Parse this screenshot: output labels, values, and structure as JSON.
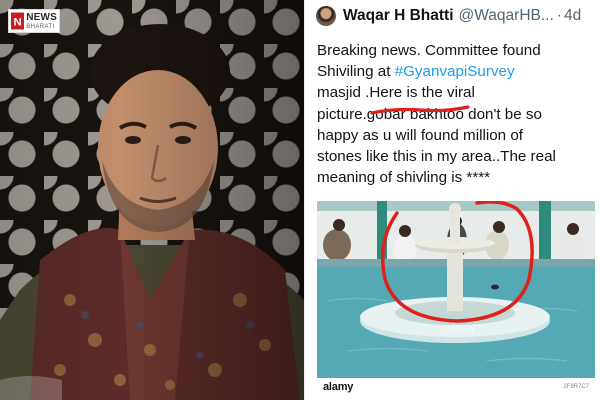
{
  "logo": {
    "line1": "NEWS",
    "line2": "BHARATI",
    "mark_letter": "N"
  },
  "tweet": {
    "display_name": "Waqar H Bhatti",
    "handle": "@WaqarHB...",
    "separator": "·",
    "time": "4d",
    "lines": [
      {
        "parts": [
          {
            "text": "Breaking news. Committee  found",
            "hashtag": false
          }
        ]
      },
      {
        "parts": [
          {
            "text": "Shiviling at ",
            "hashtag": false
          },
          {
            "text": "#GyanvapiSurvey",
            "hashtag": true
          }
        ]
      },
      {
        "parts": [
          {
            "text": "masjid  .Here is the viral",
            "hashtag": false
          }
        ]
      },
      {
        "parts": [
          {
            "text": "picture.gobar bakhtoo don't be so",
            "hashtag": false
          }
        ]
      },
      {
        "parts": [
          {
            "text": "happy as u will found  million of",
            "hashtag": false
          }
        ]
      },
      {
        "parts": [
          {
            "text": "stones like this in my area..The real",
            "hashtag": false
          }
        ]
      },
      {
        "parts": [
          {
            "text": "meaning of shivling is ****",
            "hashtag": false
          }
        ]
      }
    ],
    "media": {
      "watermark": "alamy",
      "footer_brand": "alamy",
      "image_id": "2F8R7C7"
    }
  },
  "colors": {
    "hashtag": "#1d9bf0",
    "annotation_red": "#e0201c",
    "pool_water": "#55a9b5"
  },
  "icons": {
    "avatar": "avatar-photo",
    "logo": "news-bharati-logo"
  }
}
